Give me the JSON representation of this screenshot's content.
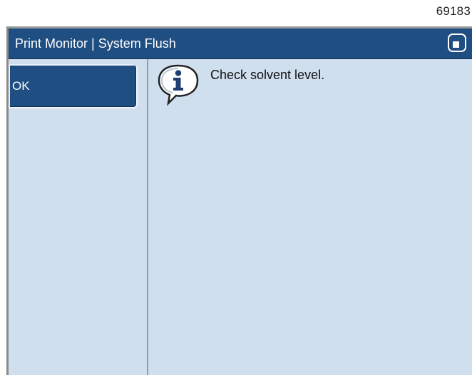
{
  "figure_number": "69183",
  "window": {
    "title": "Print Monitor | System Flush",
    "home_icon": "home-square-icon"
  },
  "sidebar": {
    "ok_label": "OK"
  },
  "message": {
    "icon": "info-icon",
    "text": "Check solvent level."
  },
  "colors": {
    "titlebar": "#1f4e82",
    "screen_background": "#cfdfee",
    "button": "#1f4e82"
  }
}
